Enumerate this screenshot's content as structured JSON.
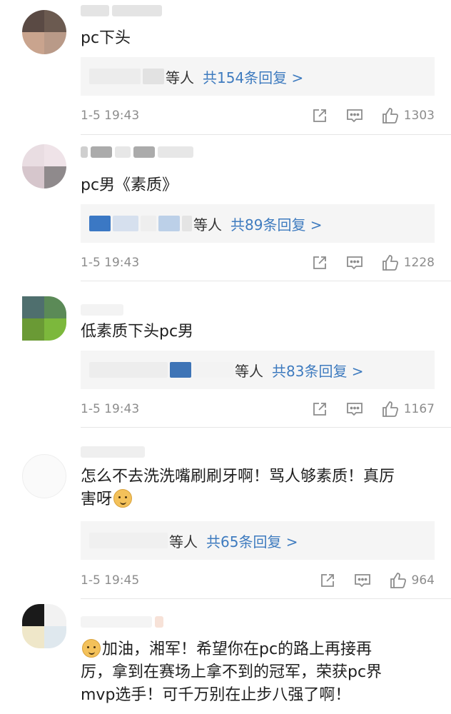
{
  "comments": [
    {
      "content": "pc下头",
      "replies_by": "等人",
      "replies_count": "共154条回复 >",
      "time": "1-5 19:43",
      "likes": "1303"
    },
    {
      "content": "pc男《素质》",
      "replies_by": "等人",
      "replies_count": "共89条回复 >",
      "time": "1-5 19:43",
      "likes": "1228"
    },
    {
      "content": "低素质下头pc男",
      "replies_by": "等人",
      "replies_count": "共83条回复 >",
      "time": "1-5 19:43",
      "likes": "1167"
    },
    {
      "content_line1": "怎么不去洗洗嘴刷刷牙啊！骂人够素质！真厉",
      "content_line2": "害呀",
      "replies_by": "等人",
      "replies_count": "共65条回复 >",
      "time": "1-5 19:45",
      "likes": "964"
    },
    {
      "content_line1": "加油，湘军！希望你在pc的路上再接再",
      "content_line2": "厉，拿到在赛场上拿不到的冠军，荣获pc界",
      "content_line3": "mvp选手！可千万别在止步八强了啊！"
    }
  ],
  "icons": {
    "share": "share-icon",
    "comment": "comment-icon",
    "like": "thumbs-up-icon",
    "emoji": "doge-emoji-icon"
  },
  "colors": {
    "reply_link": "#3e7bbf",
    "meta_text": "#8c8c8c",
    "reply_bg": "#f5f5f5"
  }
}
